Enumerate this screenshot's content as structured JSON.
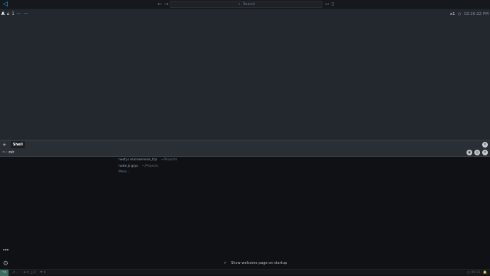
{
  "titlebar": {
    "logo_glyph": "◁",
    "back_glyph": "←",
    "forward_glyph": "→",
    "search_placeholder": "Search",
    "search_glyph": "⌕",
    "right_icons": [
      "▭",
      "▯",
      "▭",
      "▣"
    ]
  },
  "shell_bar": {
    "arch_glyph": "A",
    "home_glyph": "⌂",
    "indicator": "1",
    "dash": "— —",
    "workspace": "a1",
    "clock_glyph": "◷",
    "time": "02:26:22 PM"
  },
  "panel": {
    "add_glyph": "+",
    "tab_label": "Shell",
    "close_glyph": "×",
    "row_text": "~ : zsh",
    "row_icons": [
      "◉",
      "◎",
      "×"
    ]
  },
  "recent": {
    "items": [
      {
        "name": "nest.js microservice_tcp",
        "path": "~/Projects"
      },
      {
        "name": "node.js grpc",
        "path": "~/Projects"
      }
    ],
    "more_label": "More..."
  },
  "activity": {
    "accounts_label": "▪▪▪",
    "gear_glyph": "⚙"
  },
  "welcome": {
    "check_glyph": "✓",
    "label": "Show welcome page on startup"
  },
  "statusbar": {
    "remote_glyph": "⌥",
    "left": [
      "⎇ ...",
      "⊗ 0 △ 0",
      "⚑ 0"
    ],
    "right": [
      "◷ 00:15",
      "🔔"
    ]
  },
  "colors": {
    "accent": "#3aa0ff",
    "shell_bg": "#23272e",
    "panel_bg": "#2a2f35",
    "page_bg": "#0f1114",
    "remote_bg": "#3d6d61"
  }
}
